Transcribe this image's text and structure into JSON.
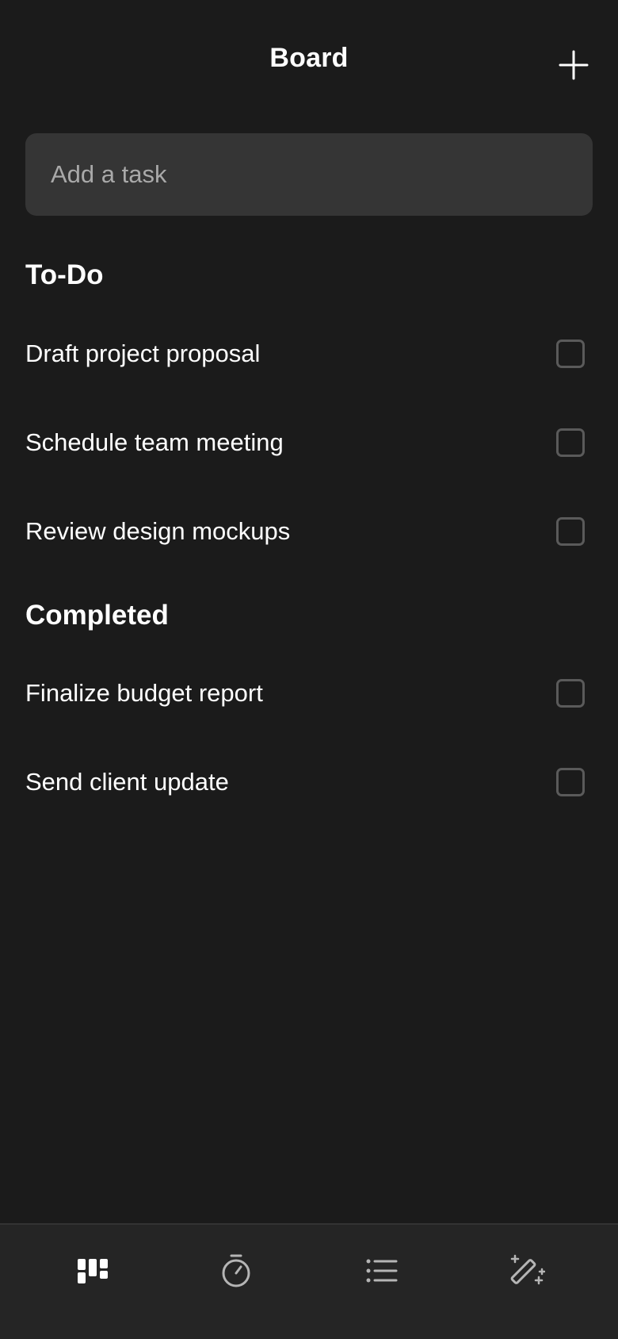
{
  "header": {
    "title": "Board",
    "add_icon": "plus-icon"
  },
  "new_task": {
    "placeholder": "Add a task",
    "value": ""
  },
  "sections": {
    "todo": {
      "heading": "To-Do",
      "tasks": [
        {
          "label": "Draft project proposal",
          "checked": false
        },
        {
          "label": "Schedule team meeting",
          "checked": false
        },
        {
          "label": "Review design mockups",
          "checked": false
        }
      ]
    },
    "completed": {
      "heading": "Completed",
      "tasks": [
        {
          "label": "Finalize budget report",
          "checked": false
        },
        {
          "label": "Send client update",
          "checked": false
        }
      ]
    }
  },
  "tabbar": {
    "tabs": [
      {
        "icon": "board-icon",
        "active": true
      },
      {
        "icon": "timer-icon",
        "active": false
      },
      {
        "icon": "list-icon",
        "active": false
      },
      {
        "icon": "magic-wand-icon",
        "active": false
      }
    ]
  },
  "colors": {
    "background": "#1b1b1b",
    "input_background": "#353535",
    "tabbar_background": "#252525",
    "text": "#ffffff",
    "placeholder": "#a9a9a9",
    "checkbox_border": "#5a5a5a",
    "inactive_icon": "#b5b5b5"
  }
}
